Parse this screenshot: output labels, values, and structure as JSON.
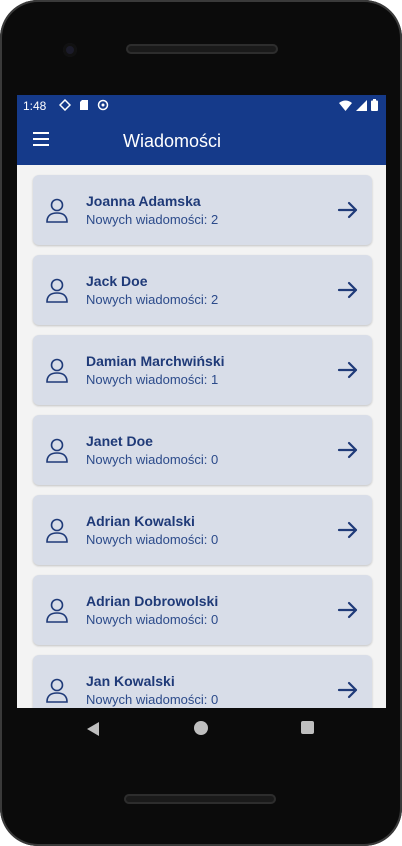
{
  "status_bar": {
    "time": "1:48"
  },
  "app_bar": {
    "title": "Wiadomości"
  },
  "conversations": [
    {
      "name": "Joanna Adamska",
      "count_label": "Nowych wiadomości: 2"
    },
    {
      "name": "Jack Doe",
      "count_label": "Nowych wiadomości: 2"
    },
    {
      "name": "Damian Marchwiński",
      "count_label": "Nowych wiadomości: 1"
    },
    {
      "name": "Janet Doe",
      "count_label": "Nowych wiadomości: 0"
    },
    {
      "name": "Adrian Kowalski",
      "count_label": "Nowych wiadomości: 0"
    },
    {
      "name": "Adrian Dobrowolski",
      "count_label": "Nowych wiadomości: 0"
    },
    {
      "name": "Jan Kowalski",
      "count_label": "Nowych wiadomości: 0"
    }
  ],
  "colors": {
    "primary": "#153a8a",
    "card": "#d8dde8",
    "text": "#1f3a78"
  },
  "icons": [
    "menu-icon",
    "user-icon",
    "arrow-right-icon"
  ]
}
